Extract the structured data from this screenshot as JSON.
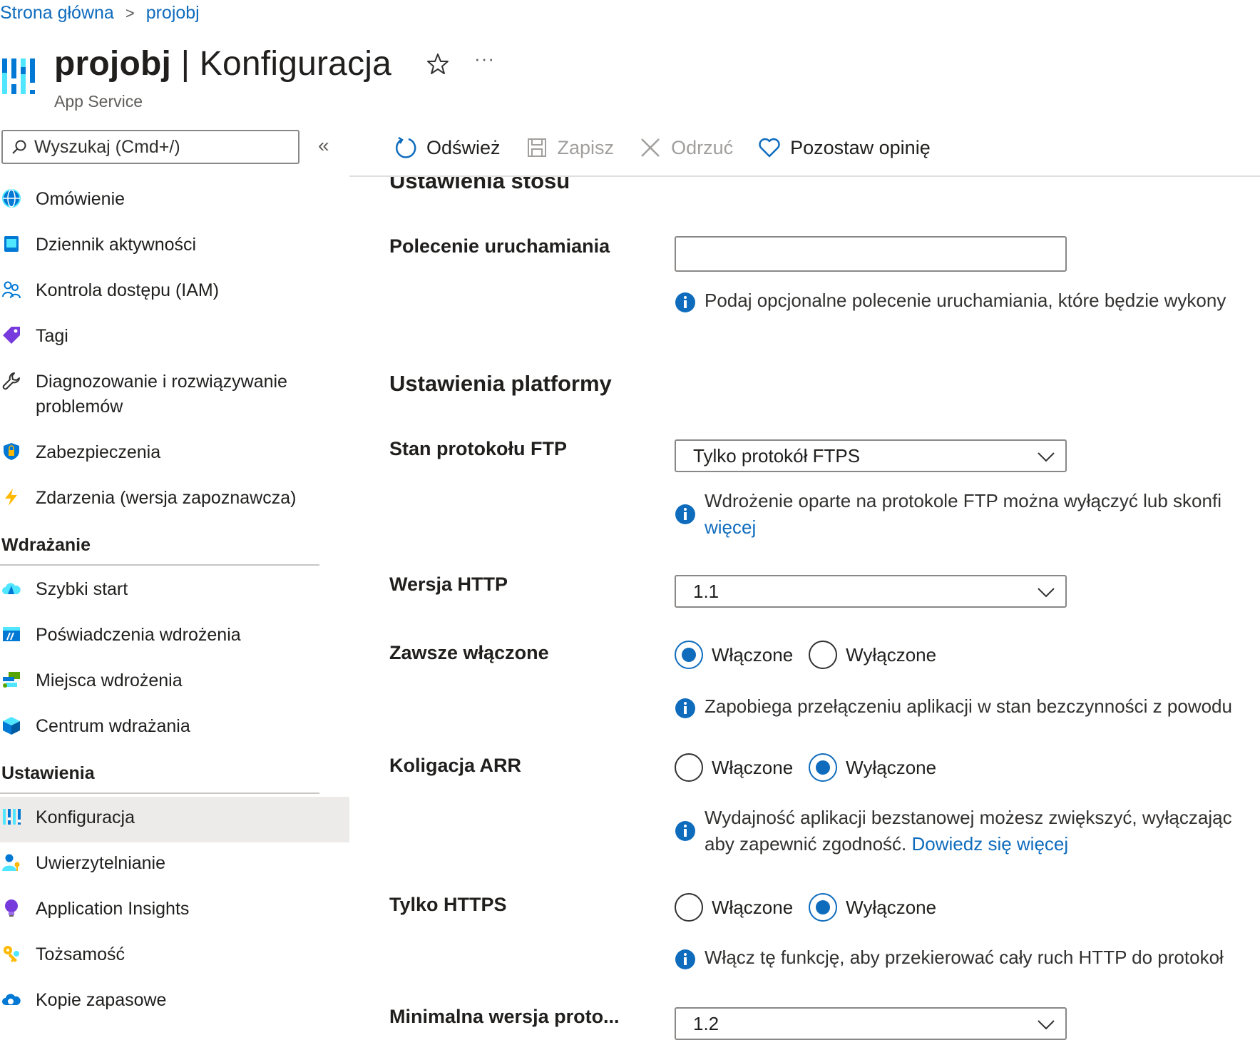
{
  "breadcrumb": {
    "home": "Strona główna",
    "current": "projobj"
  },
  "header": {
    "resource": "projobj",
    "separator": " | ",
    "page": "Konfiguracja",
    "subtitle": "App Service",
    "more": "···"
  },
  "sidebar": {
    "search_placeholder": "Wyszukaj (Cmd+/)",
    "collapse": "«",
    "items_top": [
      {
        "label": "Omówienie",
        "icon": "globe-icon"
      },
      {
        "label": "Dziennik aktywności",
        "icon": "activity-log-icon"
      },
      {
        "label": "Kontrola dostępu (IAM)",
        "icon": "users-icon"
      },
      {
        "label": "Tagi",
        "icon": "tag-icon"
      },
      {
        "label": "Diagnozowanie i rozwiązywanie problemów",
        "icon": "wrench-icon"
      },
      {
        "label": "Zabezpieczenia",
        "icon": "shield-icon"
      },
      {
        "label": "Zdarzenia (wersja zapoznawcza)",
        "icon": "lightning-icon"
      }
    ],
    "section_deploy": "Wdrażanie",
    "items_deploy": [
      {
        "label": "Szybki start",
        "icon": "cloud-icon"
      },
      {
        "label": "Poświadczenia wdrożenia",
        "icon": "credentials-icon"
      },
      {
        "label": "Miejsca wdrożenia",
        "icon": "slots-icon"
      },
      {
        "label": "Centrum wdrażania",
        "icon": "cube-icon"
      }
    ],
    "section_settings": "Ustawienia",
    "items_settings": [
      {
        "label": "Konfiguracja",
        "icon": "config-icon",
        "selected": true
      },
      {
        "label": "Uwierzytelnianie",
        "icon": "auth-icon"
      },
      {
        "label": "Application Insights",
        "icon": "lightbulb-icon"
      },
      {
        "label": "Tożsamość",
        "icon": "key-icon"
      },
      {
        "label": "Kopie zapasowe",
        "icon": "backup-icon"
      }
    ]
  },
  "toolbar": {
    "refresh": "Odśwież",
    "save": "Zapisz",
    "discard": "Odrzuć",
    "feedback": "Pozostaw opinię"
  },
  "stack": {
    "title": "Ustawienia stosu",
    "startup_label": "Polecenie uruchamiania",
    "startup_value": "",
    "startup_info": "Podaj opcjonalne polecenie uruchamiania, które będzie wykony"
  },
  "platform": {
    "title": "Ustawienia platformy",
    "ftp_label": "Stan protokołu FTP",
    "ftp_value": "Tylko protokół FTPS",
    "ftp_info": "Wdrożenie oparte na protokole FTP można wyłączyć lub skonfi",
    "ftp_info_link": "więcej",
    "http_label": "Wersja HTTP",
    "http_value": "1.1",
    "always_on_label": "Zawsze włączone",
    "always_on_value": "Włączone",
    "always_on_info": "Zapobiega przełączeniu aplikacji w stan bezczynności z powodu",
    "arr_label": "Koligacja ARR",
    "arr_value": "Wyłączone",
    "arr_info_line1": "Wydajność aplikacji bezstanowej możesz zwiększyć, wyłączając",
    "arr_info_line2": "aby zapewnić zgodność. ",
    "arr_info_link": "Dowiedz się więcej",
    "https_label": "Tylko HTTPS",
    "https_value": "Wyłączone",
    "https_info": "Włącz tę funkcję, aby przekierować cały ruch HTTP do protokoł",
    "tls_label": "Minimalna wersja proto...",
    "tls_value": "1.2",
    "on": "Włączone",
    "off": "Wyłączone"
  },
  "colors": {
    "accent": "#0f6cbd",
    "selected_bg": "#edebe9"
  }
}
